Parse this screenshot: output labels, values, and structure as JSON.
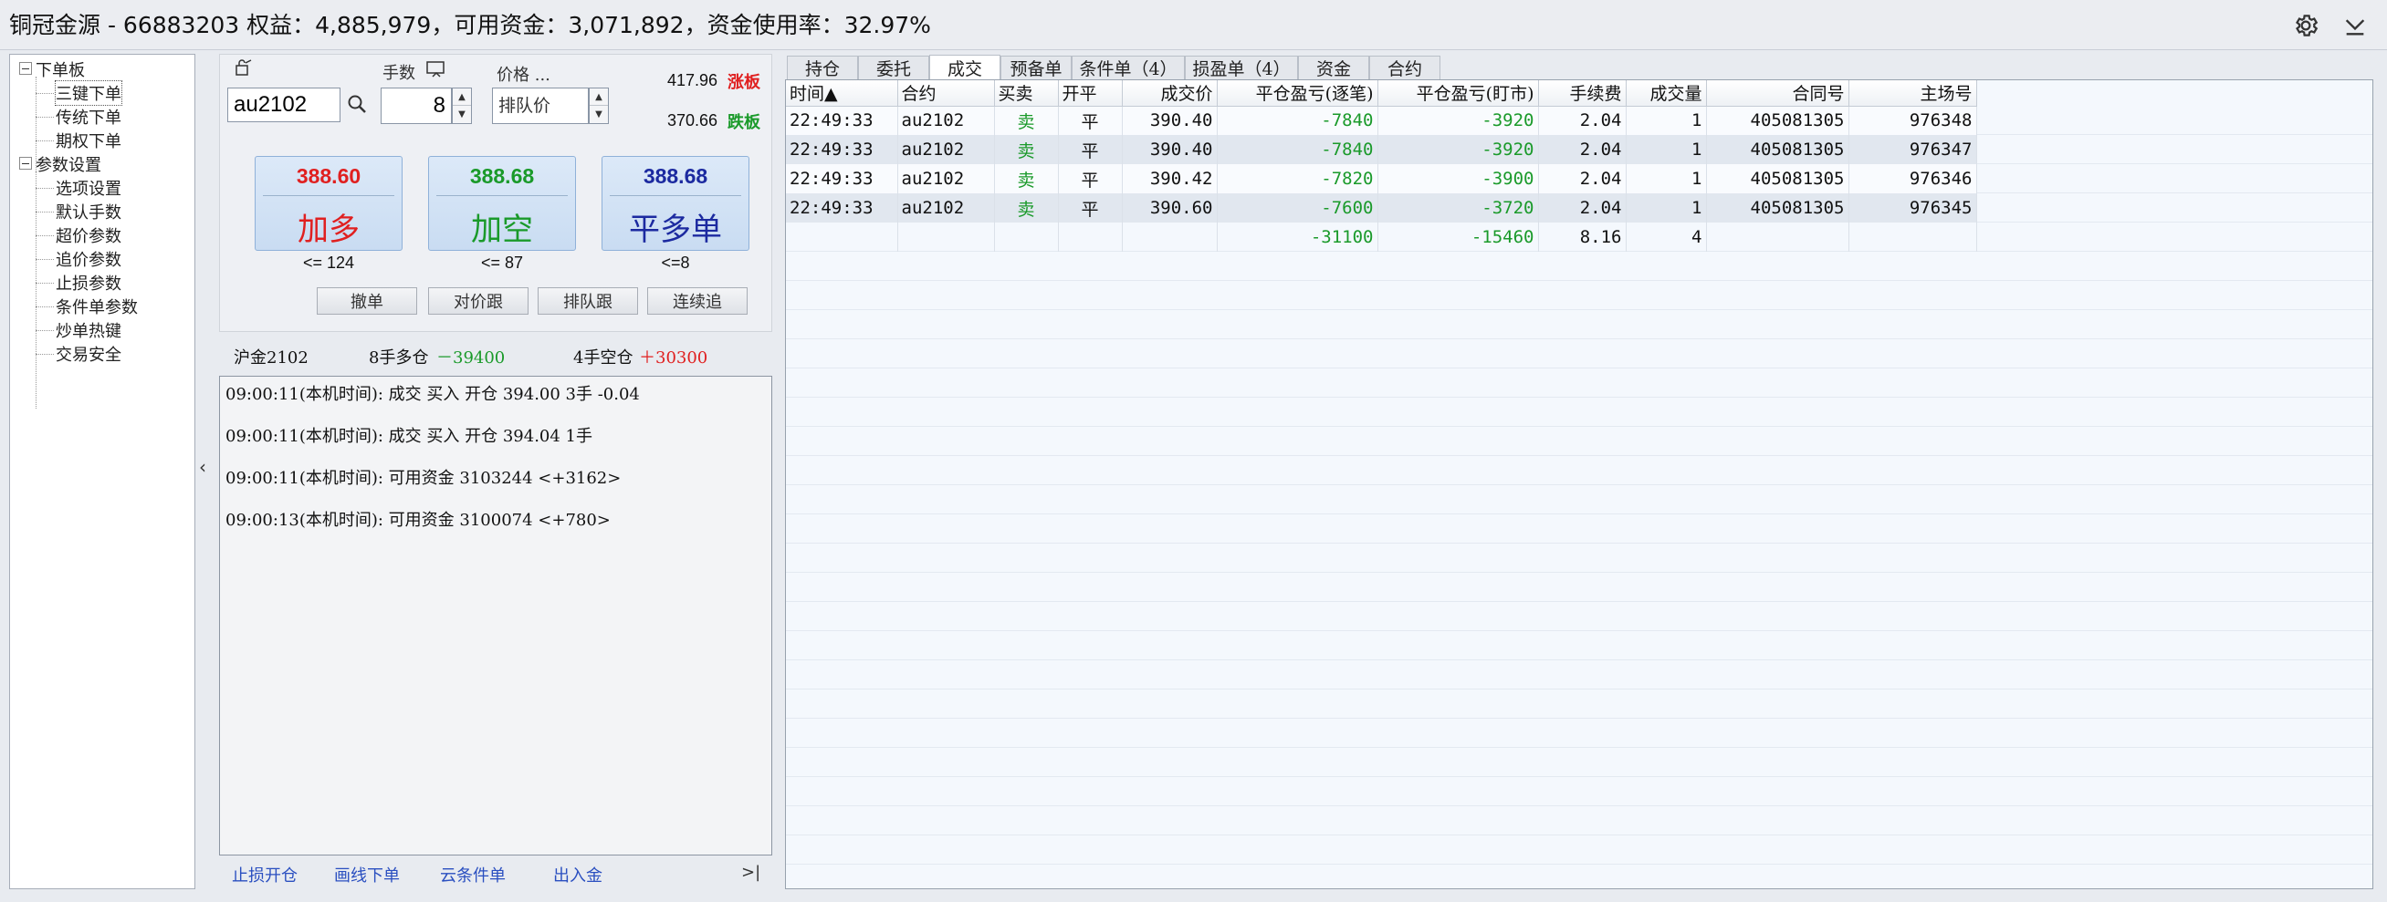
{
  "titlebar": {
    "title": "铜冠金源 - 66883203  权益：4,885,979，可用资金：3,071,892，资金使用率：32.97%",
    "settings_icon": "gear-icon",
    "menu_icon": "chevron-down-icon"
  },
  "tree": {
    "groups": [
      {
        "label": "下单板",
        "items": [
          "三键下单",
          "传统下单",
          "期权下单"
        ]
      },
      {
        "label": "参数设置",
        "items": [
          "选项设置",
          "默认手数",
          "超价参数",
          "追价参数",
          "止损参数",
          "条件单参数",
          "炒单热键",
          "交易安全"
        ]
      }
    ]
  },
  "order": {
    "contract": "au2102",
    "qty_label": "手数",
    "qty": "8",
    "price_label": "价格 ...",
    "price_mode": "排队价",
    "limit_up_price": "417.96",
    "limit_up_label": "涨板",
    "limit_down_price": "370.66",
    "limit_down_label": "跌板",
    "buttons": [
      {
        "price": "388.60",
        "label": "加多",
        "qty": "<= 124",
        "color": "#e02020"
      },
      {
        "price": "388.68",
        "label": "加空",
        "qty": "<= 87",
        "color": "#1a9a2a"
      },
      {
        "price": "388.68",
        "label": "平多单",
        "qty": "<=8",
        "color": "#1c2aa0"
      }
    ],
    "actions": [
      "撤单",
      "对价跟",
      "排队跟",
      "连续追"
    ]
  },
  "positions": {
    "contract": "沪金2102",
    "long_label": "8手多仓",
    "long_pnl": "－39400",
    "short_label": "4手空仓",
    "short_pnl": "＋30300"
  },
  "log": [
    "09:00:11(本机时间): 成交  买入  开仓  394.00  3手  -0.04",
    "09:00:11(本机时间): 成交  买入  开仓  394.04  1手",
    "09:00:11(本机时间): 可用资金 3103244  <+3162>",
    "09:00:13(本机时间): 可用资金 3100074  <+780>"
  ],
  "footer": {
    "links": [
      "止损开仓",
      "画线下单",
      "云条件单",
      "出入金"
    ],
    "collapse": ">|",
    "side_arrow": "‹"
  },
  "tabs": [
    "持仓",
    "委托",
    "成交",
    "预备单",
    "条件单（4）",
    "损盈单（4）",
    "资金",
    "合约"
  ],
  "active_tab": "成交",
  "trades": {
    "columns": [
      "时间▲",
      "合约",
      "买卖",
      "开平",
      "成交价",
      "平仓盈亏(逐笔)",
      "平仓盈亏(盯市)",
      "手续费",
      "成交量",
      "合同号",
      "主场号"
    ],
    "rows": [
      [
        "22:49:33",
        "au2102",
        "卖",
        "平",
        "390.40",
        "-7840",
        "-3920",
        "2.04",
        "1",
        "405081305",
        "976348"
      ],
      [
        "22:49:33",
        "au2102",
        "卖",
        "平",
        "390.40",
        "-7840",
        "-3920",
        "2.04",
        "1",
        "405081305",
        "976347"
      ],
      [
        "22:49:33",
        "au2102",
        "卖",
        "平",
        "390.42",
        "-7820",
        "-3900",
        "2.04",
        "1",
        "405081305",
        "976346"
      ],
      [
        "22:49:33",
        "au2102",
        "卖",
        "平",
        "390.60",
        "-7600",
        "-3720",
        "2.04",
        "1",
        "405081305",
        "976345"
      ]
    ],
    "total": [
      "",
      "",
      "",
      "",
      "",
      "-31100",
      "-15460",
      "8.16",
      "4",
      "",
      ""
    ]
  }
}
